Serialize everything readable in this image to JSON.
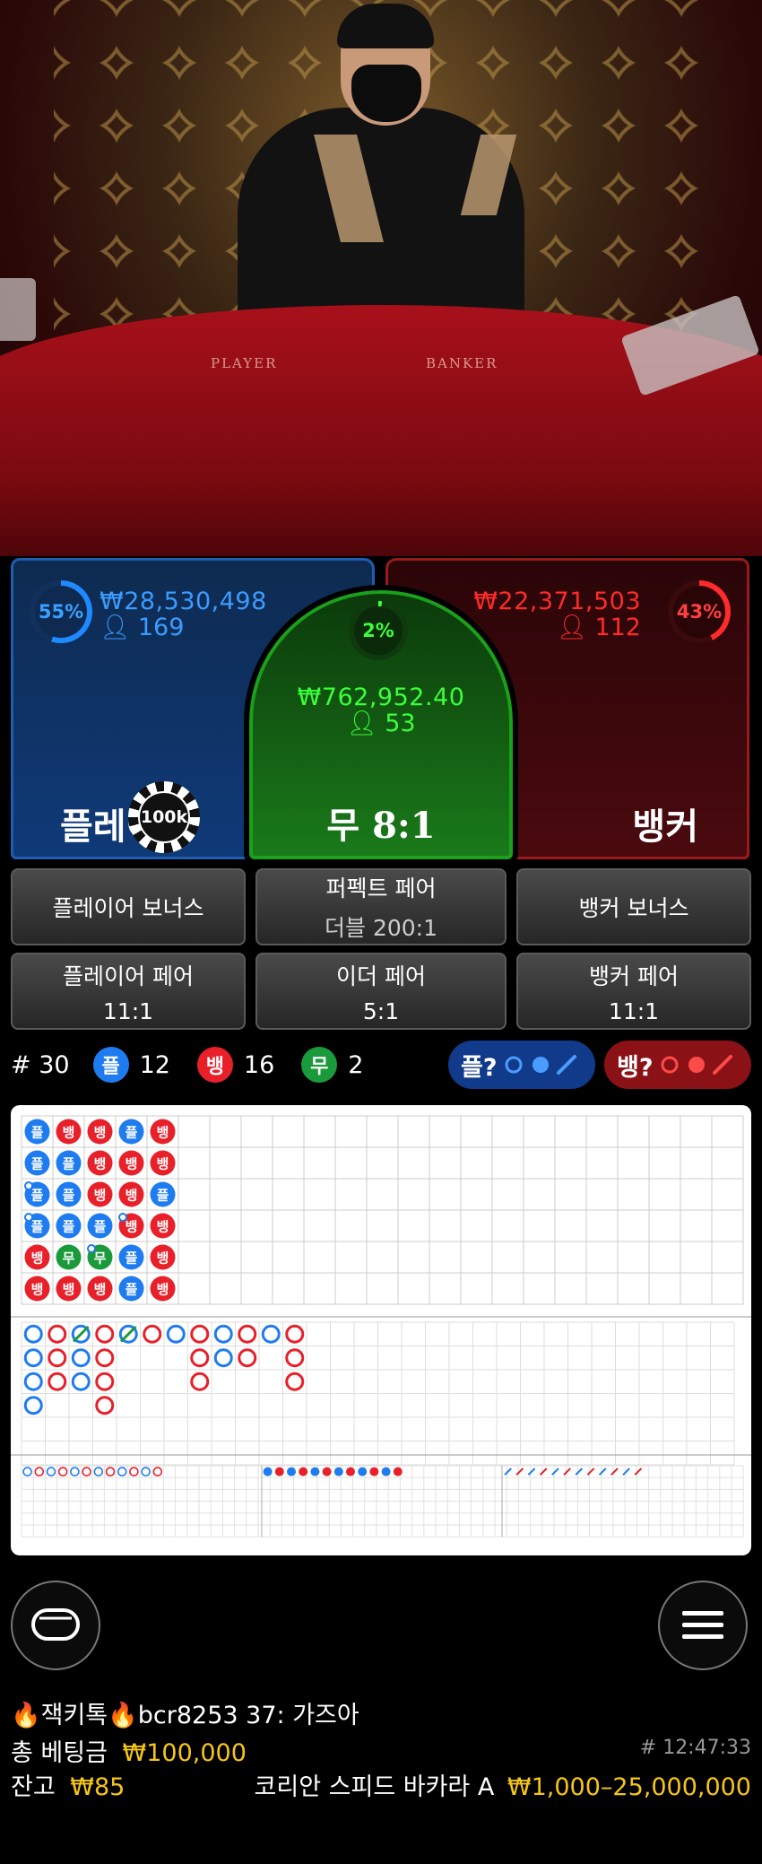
{
  "table_labels": {
    "player": "PLAYER",
    "banker": "BANKER"
  },
  "player": {
    "percent": "55%",
    "amount": "₩28,530,498",
    "count": "169",
    "label": "플레이어",
    "percent_value": 55
  },
  "banker": {
    "percent": "43%",
    "amount": "₩22,371,503",
    "count": "112",
    "label": "뱅커",
    "percent_value": 43
  },
  "tie": {
    "percent": "2%",
    "amount": "₩762,952.40",
    "count": "53",
    "label": "무 8:1",
    "percent_value": 2
  },
  "chip": {
    "value": "100k"
  },
  "side_bets": {
    "player_bonus": "플레이어 보너스",
    "perfect_pair": "퍼펙트 페어",
    "perfect_pair_odds": "더블 200:1",
    "banker_bonus": "뱅커 보너스",
    "player_pair": "플레이어 페어",
    "player_pair_odds": "11:1",
    "either_pair": "이더 페어",
    "either_pair_odds": "5:1",
    "banker_pair": "뱅커 페어",
    "banker_pair_odds": "11:1"
  },
  "stats": {
    "round_prefix": "# 30",
    "player_short": "플",
    "player_count": "12",
    "banker_short": "뱅",
    "banker_count": "16",
    "tie_short": "무",
    "tie_count": "2",
    "player_predict": "플?",
    "banker_predict": "뱅?"
  },
  "bead_road": {
    "columns": [
      [
        "플",
        "플",
        "플",
        "플",
        "뱅",
        "뱅"
      ],
      [
        "뱅",
        "플",
        "플",
        "플",
        "무",
        "뱅"
      ],
      [
        "뱅",
        "뱅",
        "뱅",
        "플",
        "무",
        "뱅"
      ],
      [
        "플",
        "뱅",
        "뱅",
        "뱅",
        "플",
        "플"
      ],
      [
        "뱅",
        "뱅",
        "플",
        "뱅",
        "뱅",
        "뱅"
      ]
    ],
    "pair_marks": [
      "0-2",
      "0-3",
      "2-4",
      "3-3"
    ]
  },
  "colors": {
    "player": "#1e7cf0",
    "banker": "#e8202a",
    "tie": "#1a9a3a",
    "gold": "#f5c518"
  },
  "icons": {
    "lobby": "chat-bubble-icon",
    "menu": "hamburger-icon"
  },
  "chat": {
    "prefix_icon": "fire-icon",
    "name1": "잭키톡",
    "name2": "bcr8253",
    "message": "37: 가즈아"
  },
  "footer": {
    "total_bet_label": "총 베팅금",
    "total_bet_value": "₩100,000",
    "round_id": "# 12:47:33",
    "balance_label": "잔고",
    "balance_value": "₩85",
    "table_name": "코리안 스피드 바카라 A",
    "limits": "₩1,000–25,000,000"
  }
}
